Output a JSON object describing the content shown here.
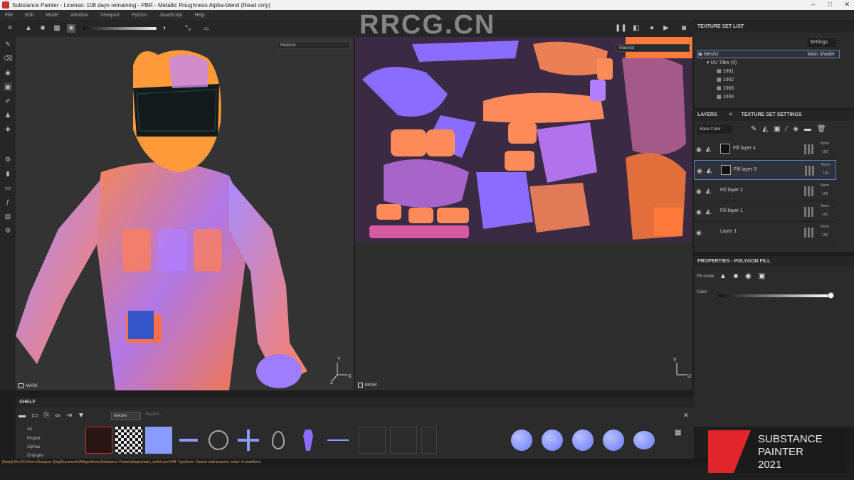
{
  "window": {
    "title": "Substance Painter - License: 108 days remaining - PBR - Metallic Roughness Alpha-blend (Read only)"
  },
  "menu": [
    "File",
    "Edit",
    "Mode",
    "Window",
    "Viewport",
    "Python",
    "JavaScript",
    "Help"
  ],
  "watermark": "RRCG.CN",
  "viewport_3d": {
    "mask_label": "MASK",
    "axes": {
      "y": "Y",
      "z": "Z",
      "x": "X"
    }
  },
  "viewport_2d": {
    "channel_dropdown": "Material",
    "channel_dropdown_2d": "Material",
    "mask_label": "MASK",
    "axes": {
      "v": "V",
      "u": "U"
    }
  },
  "texture_set_list": {
    "title": "TEXTURE SET LIST",
    "settings_label": "Settings",
    "set_name": "Mesh1",
    "shader": "Main shader",
    "uv_tiles_label": "UV Tiles (4)",
    "tiles": [
      "1001",
      "1002",
      "1003",
      "1004"
    ]
  },
  "layers_panel": {
    "tab_layers": "LAYERS",
    "tab_settings": "TEXTURE SET SETTINGS",
    "channel_select": "Base Color",
    "layers": [
      {
        "name": "Fill layer 4",
        "blend": "Norm",
        "opacity": "100"
      },
      {
        "name": "Fill layer 3",
        "blend": "Norm",
        "opacity": "100"
      },
      {
        "name": "Fill layer 2",
        "blend": "Norm",
        "opacity": "100"
      },
      {
        "name": "Fill layer 1",
        "blend": "Norm",
        "opacity": "100"
      },
      {
        "name": "Layer 1",
        "blend": "Norm",
        "opacity": "100"
      }
    ]
  },
  "properties": {
    "title": "PROPERTIES - POLYGON FILL",
    "fill_mode_label": "Fill mode",
    "color_label": "Color"
  },
  "shelf": {
    "title": "SHELF",
    "filter_chip": "texture",
    "search_placeholder": "Search...",
    "categories": [
      "All",
      "Project",
      "Alphas",
      "Grunges"
    ]
  },
  "status": {
    "message": "[Script] file:///C:/Users/Swagmo Qing/Documents/Allegorithmic/Substance Painter/plugins/auto_switch.qml:648: TypeError: Cannot read property 'value' of undefined"
  },
  "logo": {
    "line1": "SUBSTANCE",
    "line2": "PAINTER",
    "line3": "2021"
  },
  "colors": {
    "accent_orange": "#ff8a3a",
    "accent_purple": "#8a6cff",
    "logo_red": "#e0262c"
  }
}
